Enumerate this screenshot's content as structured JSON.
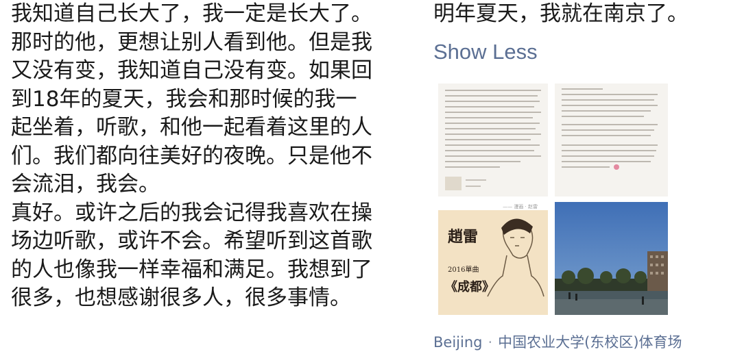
{
  "post": {
    "paragraphs": [
      "我知道自己长大了，我一定是长大了。那时的他，更想让别人看到他。但是我又没有变，我知道自己没有变。如果回到18年的夏天，我会和那时候的我一起坐着，听歌，和他一起看着这里的人们。我们都向往美好的夜晚。只是他不会流泪，我会。",
      "真好。或许之后的我会记得我喜欢在操场边听歌，或许不会。希望听到这首歌的人也像我一样幸福和满足。我想到了很多，也想感谢很多人，很多事情。"
    ],
    "continuation": "明年夏天，我就在南京了。",
    "show_less_label": "Show Less"
  },
  "images": {
    "poster_author": "趙雷",
    "poster_year": "2016單曲",
    "poster_title": "《成都》",
    "poster_caption": "—— 漫画 · 赵雷"
  },
  "location": {
    "city": "Beijing",
    "separator": "·",
    "place": "中国农业大学(东校区)体育场"
  },
  "colors": {
    "link": "#5b6f93",
    "text": "#1a1a1a"
  }
}
